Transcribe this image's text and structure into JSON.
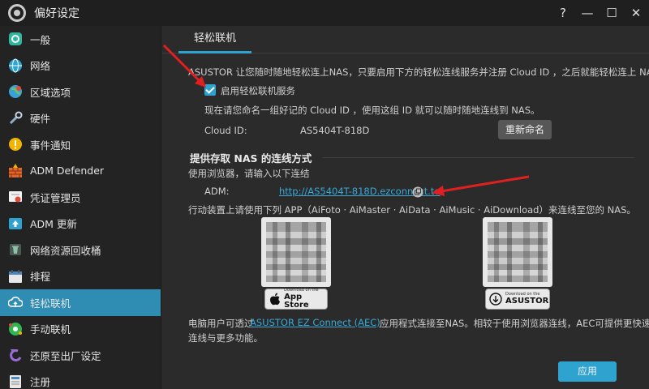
{
  "window": {
    "title": "偏好设定",
    "controls": [
      "?",
      "—",
      "☐",
      "✕"
    ]
  },
  "sidebar": {
    "items": [
      {
        "label": "一般",
        "icon": "general-icon",
        "color": "#2fb6a0"
      },
      {
        "label": "网络",
        "icon": "network-globe-icon",
        "color": "#2fa3cf"
      },
      {
        "label": "区域选项",
        "icon": "region-globe-icon",
        "color": "#3aa0d8"
      },
      {
        "label": "硬件",
        "icon": "hardware-wrench-icon",
        "color": "#8fb0c9"
      },
      {
        "label": "事件通知",
        "icon": "notification-icon",
        "color": "#f0b400"
      },
      {
        "label": "ADM Defender",
        "icon": "firewall-icon",
        "color": "#e0662a"
      },
      {
        "label": "凭证管理员",
        "icon": "certificate-icon",
        "color": "#e04a3a"
      },
      {
        "label": "ADM 更新",
        "icon": "update-icon",
        "color": "#2fa3cf"
      },
      {
        "label": "网络资源回收桶",
        "icon": "recycle-bin-icon",
        "color": "#8fc0a8"
      },
      {
        "label": "排程",
        "icon": "schedule-icon",
        "color": "#4a8ac0"
      },
      {
        "label": "轻松联机",
        "icon": "cloud-connect-icon",
        "color": "#ffffff",
        "active": true
      },
      {
        "label": "手动联机",
        "icon": "manual-connect-icon",
        "color": "#2fb650"
      },
      {
        "label": "还原至出厂设定",
        "icon": "factory-reset-icon",
        "color": "#9b6bd6"
      },
      {
        "label": "注册",
        "icon": "register-icon",
        "color": "#4a8ac0"
      }
    ]
  },
  "tab": {
    "label": "轻松联机"
  },
  "content": {
    "intro": "ASUSTOR 让您随时随地轻松连上NAS，只要启用下方的轻松连线服务并注册 Cloud ID ，之后就能轻松连上 NAS。",
    "enable_label": "启用轻松联机服务",
    "enable_checked": true,
    "cloud_id_hint": "现在请您命名一组好记的 Cloud ID ，使用这组 ID 就可以随时随地连线到 NAS。",
    "cloud_id_label": "Cloud ID:",
    "cloud_id_value": "AS5404T-818D",
    "rename_button": "重新命名",
    "section_title": "提供存取 NAS 的连线方式",
    "browser_hint": "使用浏览器，请输入以下连结",
    "adm_label": "ADM:",
    "adm_link": "http://AS5404T-818D.ezconnect.to",
    "app_hint": "行动装置上请使用下列 APP（AiFoto · AiMaster · AiData · AiMusic ·  AiDownload）来连线至您的 NAS。",
    "appstore_small": "Download on the",
    "appstore_big": "App Store",
    "asustor_small": "Download on the",
    "asustor_big": "ASUSTOR",
    "pc_text_before": "电脑用户可透过",
    "pc_link": "ASUSTOR EZ Connect (AEC)",
    "pc_text_after": "应用程式连接至NAS。相较于使用浏览器连线，AEC可提供更快速，稳定",
    "pc_text_line2": "连线与更多功能。",
    "apply_button": "应用"
  },
  "colors": {
    "accent": "#2fa3cf",
    "arrow": "#e02020"
  }
}
